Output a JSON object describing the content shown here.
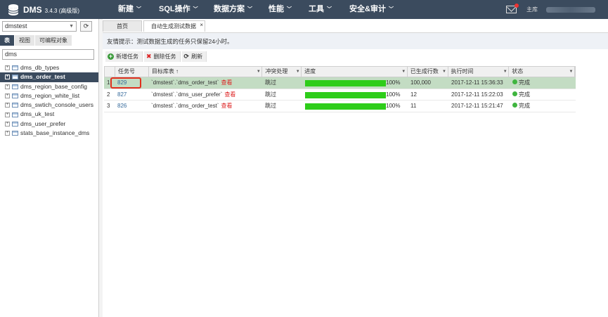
{
  "app": {
    "name": "DMS",
    "version": "3.4.3",
    "edition": "(高级版)"
  },
  "nav": {
    "items": [
      {
        "label": "新建",
        "name": "nav-new"
      },
      {
        "label": "SQL操作",
        "name": "nav-sql"
      },
      {
        "label": "数据方案",
        "name": "nav-data-plan"
      },
      {
        "label": "性能",
        "name": "nav-performance"
      },
      {
        "label": "工具",
        "name": "nav-tools"
      },
      {
        "label": "安全&审计",
        "name": "nav-security"
      }
    ],
    "user_label": "主库"
  },
  "sidebar": {
    "database": "dmstest",
    "tabs": [
      "表",
      "视图",
      "可编程对象"
    ],
    "filter": "dms",
    "items": [
      {
        "label": "dms_db_types",
        "selected": false
      },
      {
        "label": "dms_order_test",
        "selected": true
      },
      {
        "label": "dms_region_base_config",
        "selected": false
      },
      {
        "label": "dms_region_white_list",
        "selected": false
      },
      {
        "label": "dms_swtich_console_users",
        "selected": false
      },
      {
        "label": "dms_uk_test",
        "selected": false
      },
      {
        "label": "dms_user_prefer",
        "selected": false
      },
      {
        "label": "stats_base_instance_dms",
        "selected": false
      }
    ]
  },
  "tabs": [
    {
      "label": "首页",
      "active": false
    },
    {
      "label": "自动生成测试数据",
      "active": true
    }
  ],
  "tip": "友情提示：测试数据生成的任务只保留24小时。",
  "toolbar": {
    "add": "新增任务",
    "delete": "删除任务",
    "refresh": "刷新"
  },
  "grid": {
    "headers": {
      "id": "任务号",
      "table": "目标库表 ↑",
      "conflict": "冲突处理",
      "progress": "进度",
      "rows": "已生成行数",
      "time": "执行时间",
      "status": "状态"
    },
    "rows": [
      {
        "idx": "1",
        "id": "829",
        "table": "`dmstest`.`dms_order_test`",
        "view": "查看",
        "conflict": "跳过",
        "progress": 1.0,
        "progress_text": "100%",
        "rows": "100,000",
        "time": "2017-12-11 15:36:33",
        "status": "完成",
        "selected": true
      },
      {
        "idx": "2",
        "id": "827",
        "table": "`dmstest`.`dms_user_prefer`",
        "view": "查看",
        "conflict": "跳过",
        "progress": 1.0,
        "progress_text": "100%",
        "rows": "12",
        "time": "2017-12-11 15:22:03",
        "status": "完成",
        "selected": false
      },
      {
        "idx": "3",
        "id": "826",
        "table": "`dmstest`.`dms_order_test`",
        "view": "查看",
        "conflict": "跳过",
        "progress": 1.0,
        "progress_text": "100%",
        "rows": "11",
        "time": "2017-12-11 15:21:47",
        "status": "完成",
        "selected": false
      }
    ]
  },
  "colors": {
    "nav_bg": "#3b4b5e",
    "progress": "#2ecd1a",
    "selected_row": "#c3dcc3",
    "link": "#356a9b",
    "view_link": "#dd2222",
    "highlight": "#e0301e"
  }
}
